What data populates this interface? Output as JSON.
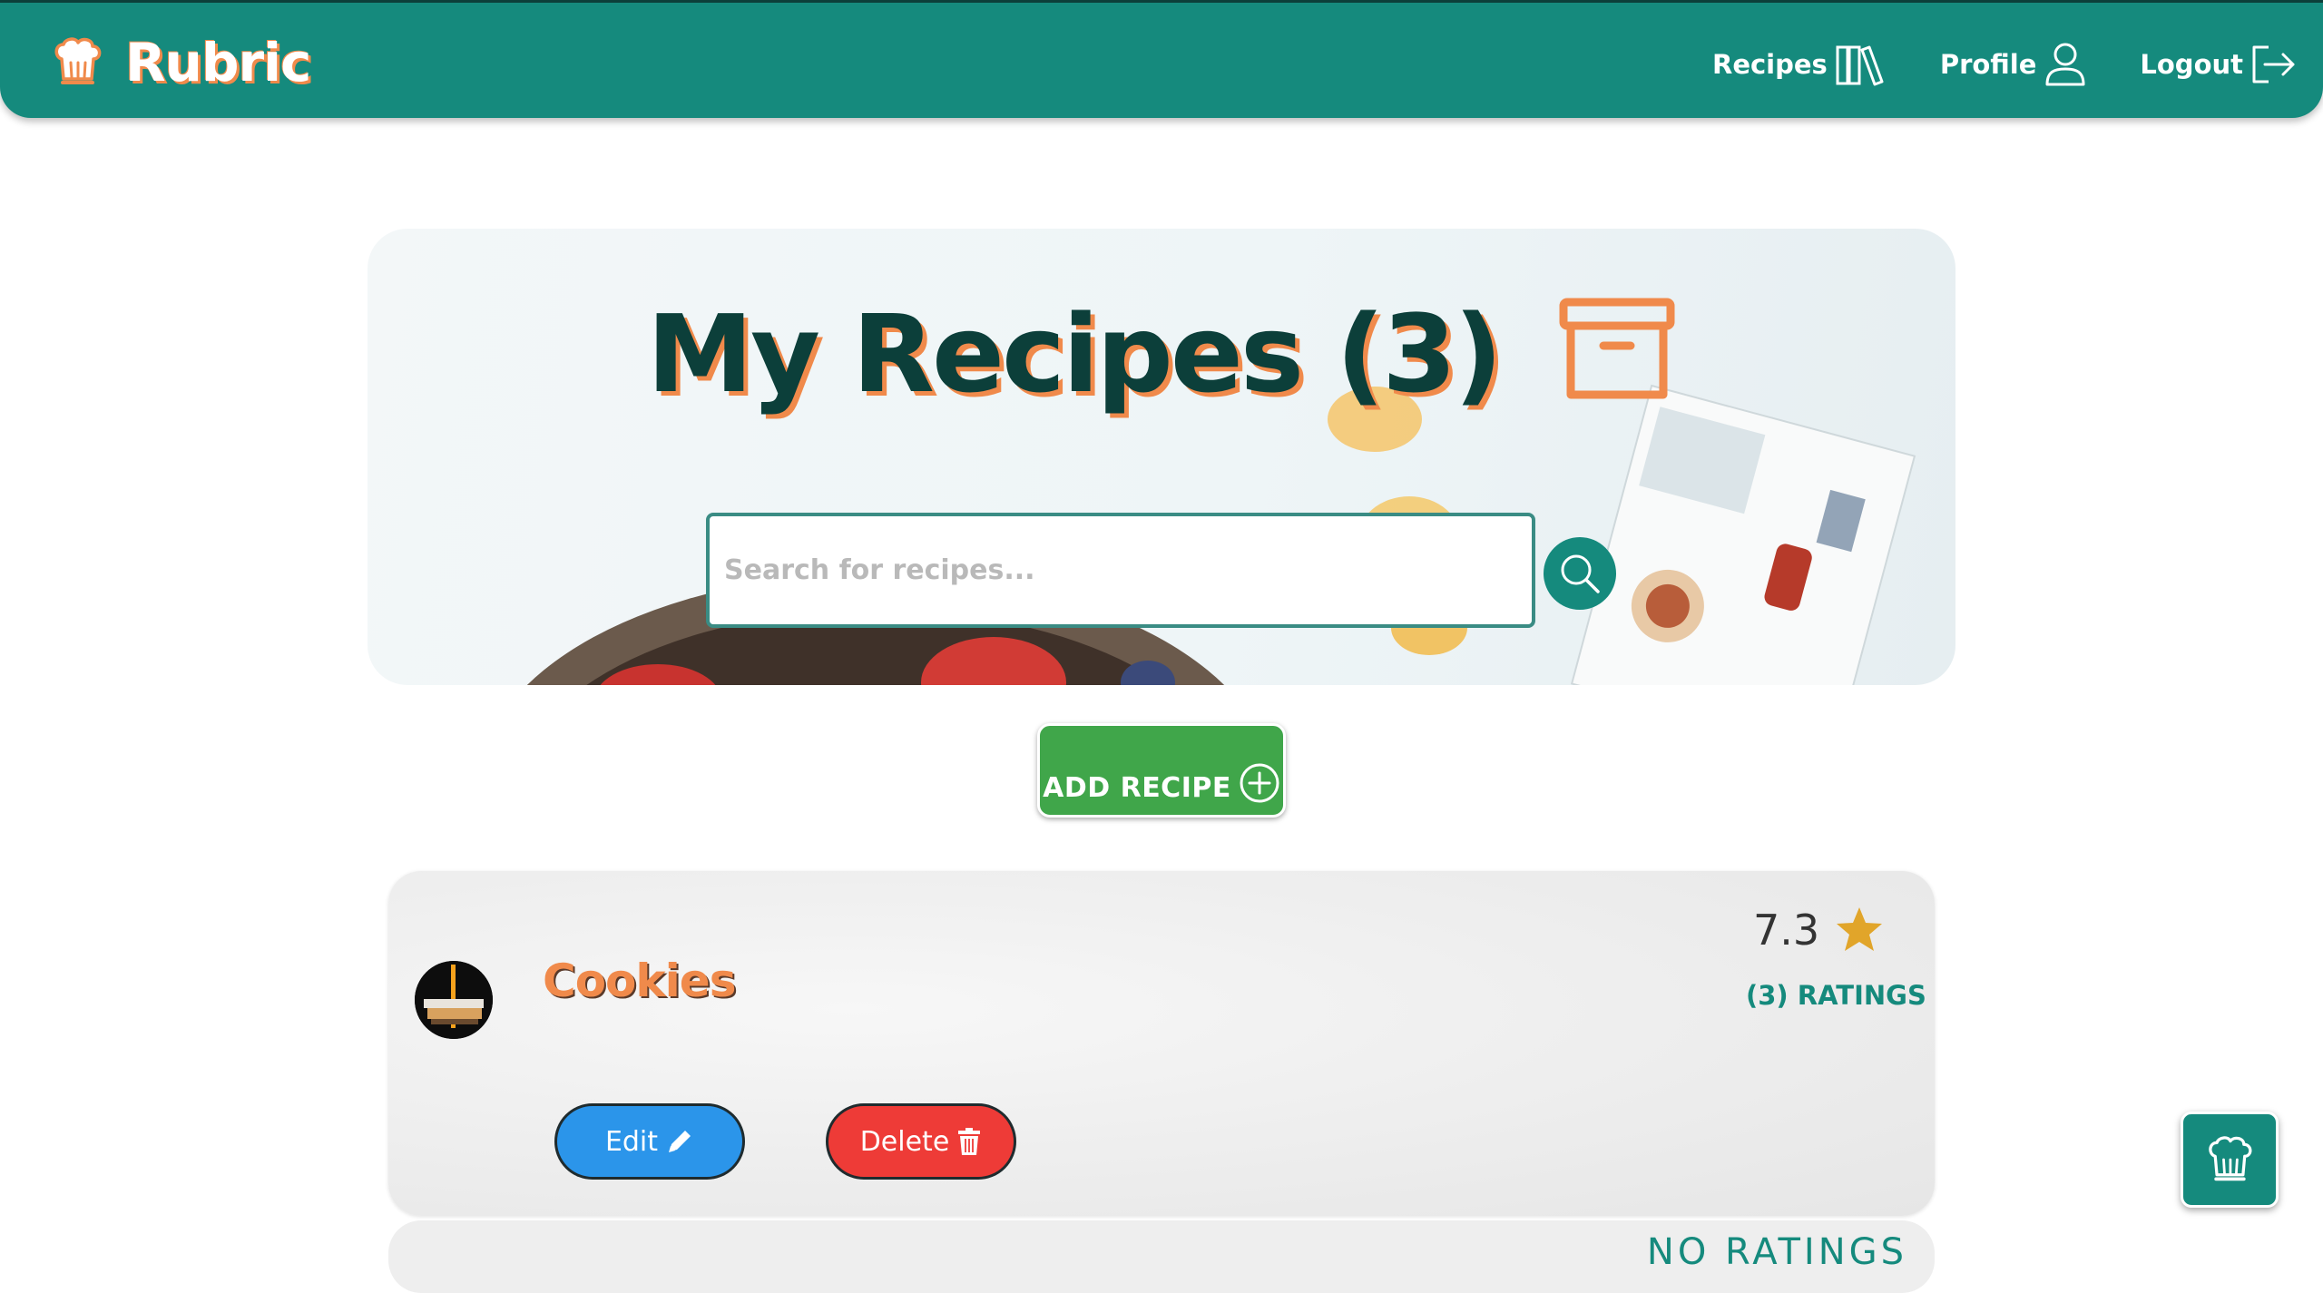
{
  "app": {
    "brand_name": "Rubric"
  },
  "nav": {
    "recipes_label": "Recipes",
    "profile_label": "Profile",
    "logout_label": "Logout"
  },
  "hero": {
    "title": "My Recipes (3)",
    "search_placeholder": "Search for recipes...",
    "search_value": ""
  },
  "actions": {
    "add_recipe_label": "ADD RECIPE"
  },
  "recipes": [
    {
      "title": "Cookies",
      "rating": "7.3",
      "ratings_count": "(3) RATINGS",
      "edit_label": "Edit",
      "delete_label": "Delete"
    },
    {
      "ratings_count": "NO RATINGS"
    }
  ],
  "colors": {
    "primary": "#158a7d",
    "dark": "#0c3f3a",
    "accent": "#f08a4b",
    "add_green": "#40a64a",
    "edit_blue": "#2b95ea",
    "delete_red": "#ee3b37",
    "star": "#e1a52a"
  },
  "icons": {
    "brand": "chef-hat-icon",
    "recipes": "books-icon",
    "profile": "user-icon",
    "logout": "logout-icon",
    "archive": "archive-box-icon",
    "search": "search-icon",
    "add": "plus-circle-icon",
    "rating": "star-icon",
    "edit": "pencil-icon",
    "delete": "trash-icon",
    "floating": "chef-hat-icon"
  }
}
